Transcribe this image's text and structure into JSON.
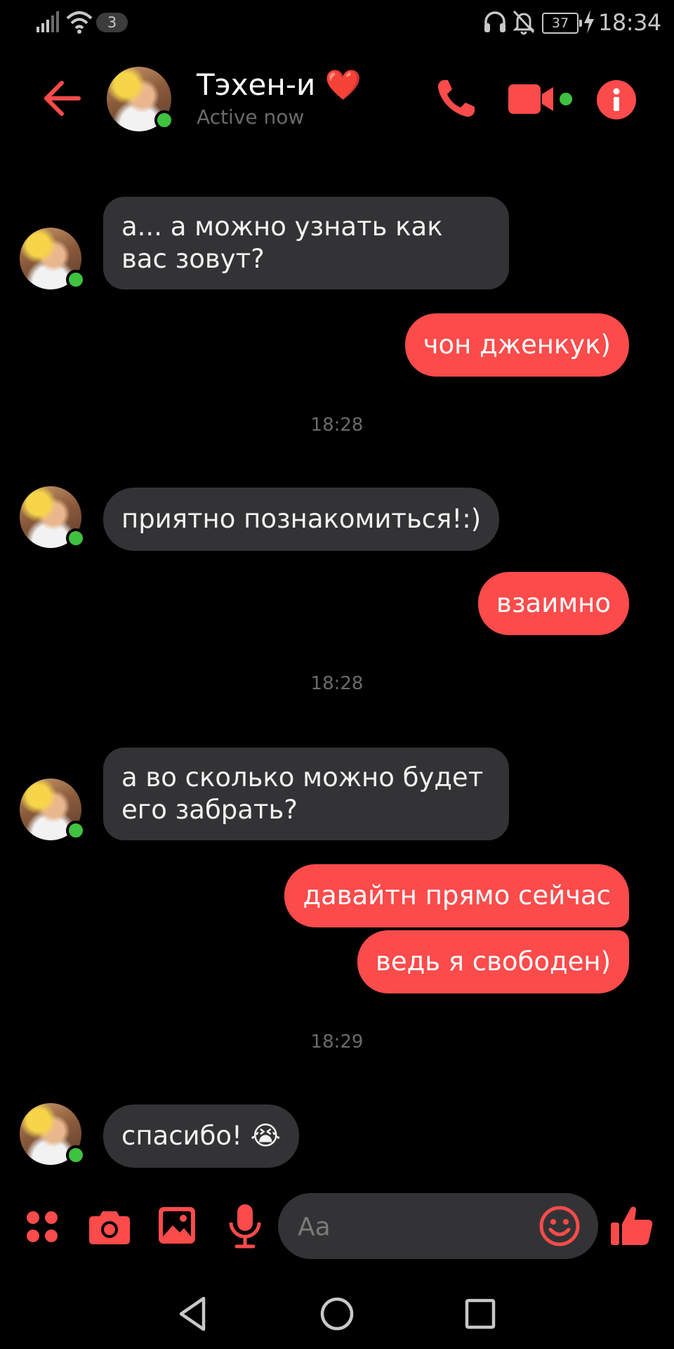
{
  "status_bar": {
    "notification_count": "3",
    "battery_level": "37",
    "time": "18:34"
  },
  "header": {
    "contact_name": "Тэхен-и ❤️",
    "status": "Active now"
  },
  "messages": [
    {
      "direction": "in",
      "text": "а... а можно узнать как вас зовут?"
    },
    {
      "direction": "out",
      "text": "чон дженкук)"
    },
    {
      "timestamp": "18:28"
    },
    {
      "direction": "in",
      "text": "приятно познакомиться!:)"
    },
    {
      "direction": "out",
      "text": "взаимно"
    },
    {
      "timestamp": "18:28"
    },
    {
      "direction": "in",
      "text": "а во сколько можно будет его забрать?"
    },
    {
      "direction": "out",
      "text": "давайтн прямо сейчас"
    },
    {
      "direction": "out",
      "text": "ведь я свободен)"
    },
    {
      "timestamp": "18:29"
    },
    {
      "direction": "in",
      "text": "спасибо! 😭"
    }
  ],
  "composer": {
    "placeholder": "Aa",
    "icons": [
      "apps-icon",
      "camera-icon",
      "gallery-icon",
      "microphone-icon",
      "emoji-icon",
      "thumbs-up-icon"
    ]
  },
  "nav_bar": {
    "icons": [
      "back-triangle-icon",
      "home-circle-icon",
      "recents-square-icon"
    ]
  },
  "colors": {
    "accent": "#fb4b4b",
    "incoming_bubble": "#333335",
    "online": "#3fc23f",
    "background": "#000000"
  }
}
